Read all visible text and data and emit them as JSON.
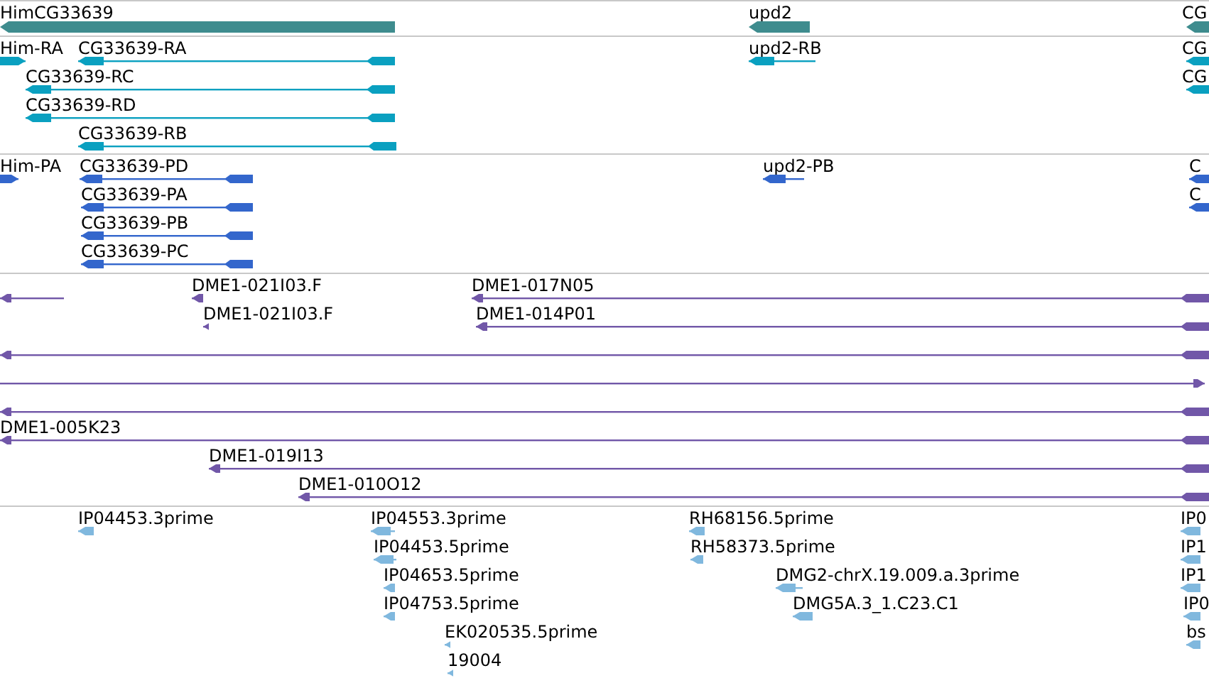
{
  "tracks": [
    {
      "kind": "gene",
      "color": "#3e8c8e",
      "features": [
        {
          "label": "HimCG33639",
          "reverse": true
        },
        {
          "label": "upd2",
          "reverse": true
        },
        {
          "label": "CG",
          "reverse": true
        }
      ]
    },
    {
      "kind": "transcript",
      "color": "#0aa0c0",
      "features": [
        {
          "label": "Him-RA",
          "reverse": false
        },
        {
          "label": "CG33639-RA",
          "reverse": true
        },
        {
          "label": "CG33639-RC",
          "reverse": true
        },
        {
          "label": "CG33639-RD",
          "reverse": true
        },
        {
          "label": "CG33639-RB",
          "reverse": true
        },
        {
          "label": "upd2-RB",
          "reverse": true
        },
        {
          "label": "CG",
          "reverse": true
        },
        {
          "label": "CG",
          "reverse": true
        }
      ]
    },
    {
      "kind": "protein",
      "color": "#3366cc",
      "features": [
        {
          "label": "Him-PA",
          "reverse": false
        },
        {
          "label": "CG33639-PD",
          "reverse": true
        },
        {
          "label": "CG33639-PA",
          "reverse": true
        },
        {
          "label": "CG33639-PB",
          "reverse": true
        },
        {
          "label": "CG33639-PC",
          "reverse": true
        },
        {
          "label": "upd2-PB",
          "reverse": true
        },
        {
          "label": "C",
          "reverse": true
        },
        {
          "label": "C",
          "reverse": true
        }
      ]
    },
    {
      "kind": "clone",
      "color": "#7157a8",
      "features": [
        {
          "reverse": true
        },
        {
          "label": "DME1-021I03.F",
          "reverse": true
        },
        {
          "label": "DME1-021I03.F",
          "reverse": true
        },
        {
          "label": "DME1-017N05",
          "reverse": true
        },
        {
          "label": "DME1-014P01",
          "reverse": true
        },
        {
          "reverse": true
        },
        {
          "reverse": false
        },
        {
          "reverse": true
        },
        {
          "label": "DME1-005K23",
          "reverse": true
        },
        {
          "label": "DME1-019I13",
          "reverse": true
        },
        {
          "label": "DME1-010O12",
          "reverse": true
        }
      ]
    },
    {
      "kind": "est",
      "color": "#80b8de",
      "features": [
        {
          "label": "IP04453.3prime",
          "reverse": true
        },
        {
          "label": "IP04553.3prime",
          "reverse": true
        },
        {
          "label": "IP04453.5prime",
          "reverse": true
        },
        {
          "label": "IP04653.5prime",
          "reverse": true
        },
        {
          "label": "IP04753.5prime",
          "reverse": true
        },
        {
          "label": "EK020535.5prime",
          "reverse": true
        },
        {
          "label": "19004",
          "reverse": true
        },
        {
          "label": "RH68156.5prime",
          "reverse": true
        },
        {
          "label": "RH58373.5prime",
          "reverse": true
        },
        {
          "label": "DMG2-chrX.19.009.a.3prime",
          "reverse": true
        },
        {
          "label": "DMG5A.3_1.C23.C1",
          "reverse": true
        },
        {
          "label": "IP0",
          "reverse": true
        },
        {
          "label": "IP1",
          "reverse": true
        },
        {
          "label": "IP1",
          "reverse": true
        },
        {
          "label": "IP0",
          "reverse": true
        },
        {
          "label": "bs",
          "reverse": true
        }
      ]
    }
  ]
}
